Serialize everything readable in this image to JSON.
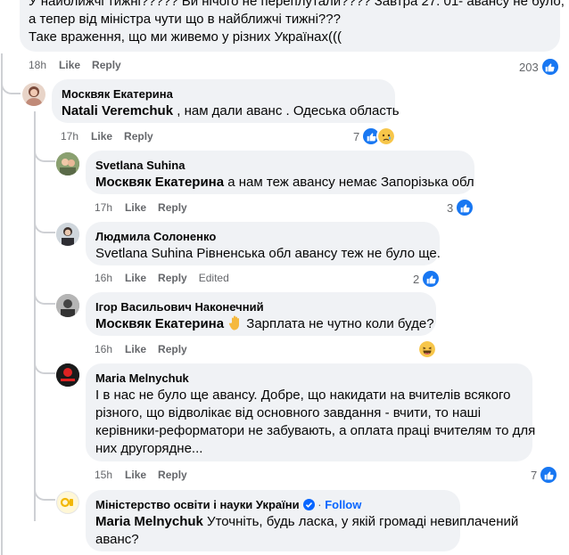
{
  "top_comment": {
    "lines": [
      "У найближчі тижні????? Ви нічого не переплутали???? Завтра 27. 01- авансу не було,",
      "а тепер від міністра чути що в найближчі тижні???",
      "Таке враження, що ми живемо у різних Українах((("
    ],
    "time": "18h",
    "like_label": "Like",
    "reply_label": "Reply",
    "reaction_count": "203"
  },
  "replies": [
    {
      "author": "Москвяк Екатерина",
      "mention": "Natali Veremchuk",
      "text": " , нам дали аванс . Одеська область",
      "time": "17h",
      "like_label": "Like",
      "reply_label": "Reply",
      "reaction_count": "7"
    },
    {
      "author": "Svetlana Suhina",
      "mention": "Москвяк Екатерина",
      "text": " а нам теж авансу немає Запорізька обл",
      "time": "17h",
      "like_label": "Like",
      "reply_label": "Reply",
      "reaction_count": "3"
    },
    {
      "author": "Людмила Солоненко",
      "text": "Svetlana Suhina Рівненська обл авансу теж не було ще.",
      "time": "16h",
      "like_label": "Like",
      "reply_label": "Reply",
      "edited_label": "Edited",
      "reaction_count": "2"
    },
    {
      "author": "Ігор Васильович Наконечний",
      "mention": "Москвяк Екатерина",
      "text": " Зарплата не чутно коли буде?",
      "time": "16h",
      "like_label": "Like",
      "reply_label": "Reply"
    },
    {
      "author": "Maria Melnychuk",
      "lines": [
        "І в нас не було ще авансу. Добре, що накидати на вчителів всякого",
        "різного, що відволікає від основного завдання - вчити, то наші",
        "керівники-реформатори не забувають, а оплата праці вчителям то для",
        "них другорядне..."
      ],
      "time": "15h",
      "like_label": "Like",
      "reply_label": "Reply",
      "reaction_count": "7"
    },
    {
      "author": "Міністерство освіти і науки України",
      "follow_label": "Follow",
      "mention": "Maria Melnychuk",
      "text": " Уточніть, будь ласка, у якій громаді невиплачений",
      "text_line2": "аванс?"
    }
  ],
  "colors": {
    "bubble": "#f0f2f5",
    "like_blue": "#1877f2",
    "follow_blue": "#0866ff",
    "meta_gray": "#65676b",
    "thread_line": "#ced0d4"
  },
  "icons": [
    "like-icon",
    "haha-icon",
    "sad-icon",
    "waving-hand-emoji",
    "verified-badge-icon"
  ]
}
